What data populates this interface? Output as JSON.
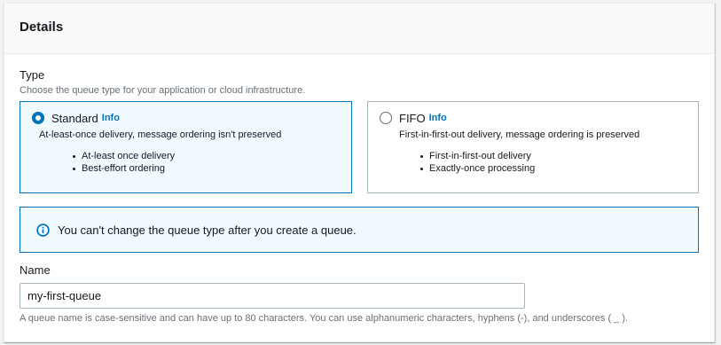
{
  "details": {
    "title": "Details"
  },
  "type_section": {
    "label": "Type",
    "description": "Choose the queue type for your application or cloud infrastructure.",
    "options": [
      {
        "title": "Standard",
        "info": "Info",
        "description": "At-least-once delivery, message ordering isn't preserved",
        "bullets": [
          "At-least once delivery",
          "Best-effort ordering"
        ],
        "selected": true
      },
      {
        "title": "FIFO",
        "info": "Info",
        "description": "First-in-first-out delivery, message ordering is preserved",
        "bullets": [
          "First-in-first-out delivery",
          "Exactly-once processing"
        ],
        "selected": false
      }
    ]
  },
  "alert": {
    "icon": "info-icon",
    "text": "You can't change the queue type after you create a queue."
  },
  "name_field": {
    "label": "Name",
    "value": "my-first-queue",
    "constraint": "A queue name is case-sensitive and can have up to 80 characters. You can use alphanumeric characters, hyphens (-), and underscores ( _ )."
  },
  "colors": {
    "accent": "#0073bb",
    "selected_bg": "#f1faff",
    "border": "#aab7b8"
  }
}
